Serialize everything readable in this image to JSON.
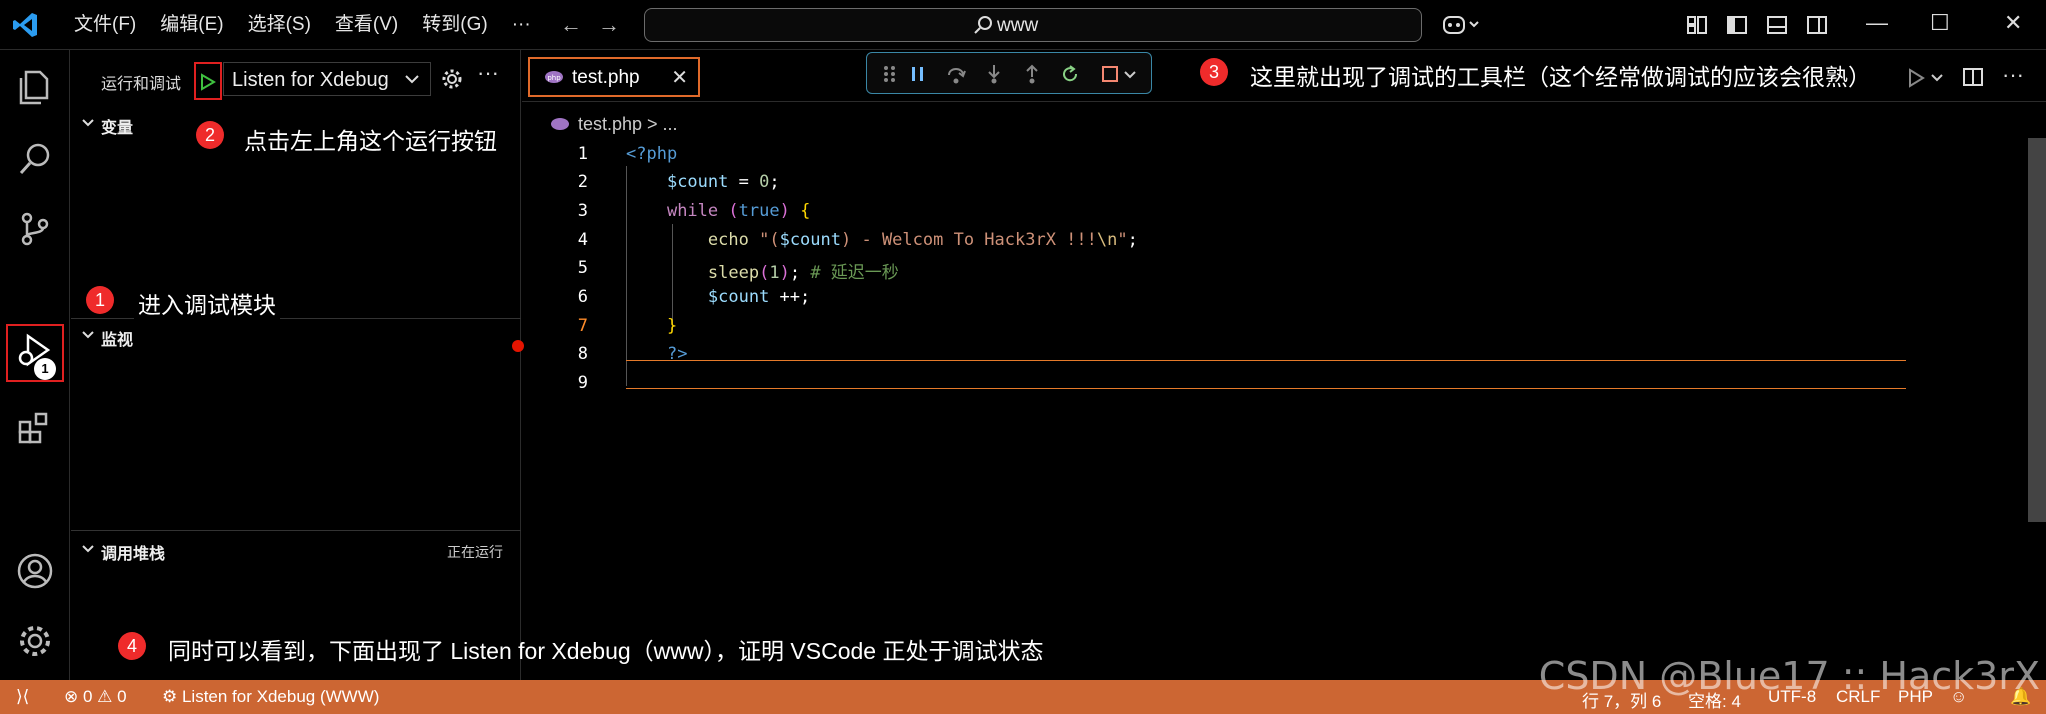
{
  "titlebar": {
    "menu": [
      "文件(F)",
      "编辑(E)",
      "选择(S)",
      "查看(V)",
      "转到(G)",
      "···"
    ],
    "search_text": "www"
  },
  "sidebar": {
    "title": "运行和调试",
    "config": "Listen for Xdebug",
    "sections": {
      "variables": "变量",
      "watch": "监视",
      "callstack": "调用堆栈",
      "callstack_status": "正在运行"
    }
  },
  "activity": {
    "debug_badge": "1"
  },
  "editor": {
    "tab_label": "test.php",
    "breadcrumb": "test.php > ...",
    "lines": [
      "1",
      "2",
      "3",
      "4",
      "5",
      "6",
      "7",
      "8",
      "9"
    ]
  },
  "annotations": {
    "a1_num": "1",
    "a1": "进入调试模块",
    "a2_num": "2",
    "a2": "点击左上角这个运行按钮",
    "a3_num": "3",
    "a3": "这里就出现了调试的工具栏（这个经常做调试的应该会很熟）",
    "a4_num": "4",
    "a4": "同时可以看到，下面出现了 Listen for Xdebug（www），证明 VSCode 正处于调试状态"
  },
  "statusbar": {
    "problems": "⊗ 0 ⚠ 0",
    "debug": "Listen for Xdebug (WWW)",
    "position": "行 7，列 6",
    "spaces": "空格: 4",
    "encoding": "UTF-8",
    "eol": "CRLF",
    "lang": "PHP"
  },
  "watermark": "CSDN @Blue17 :: Hack3rX",
  "colors": {
    "status": "#cc6633",
    "annotation": "#ef2b2b",
    "highlight": "#e02020"
  }
}
